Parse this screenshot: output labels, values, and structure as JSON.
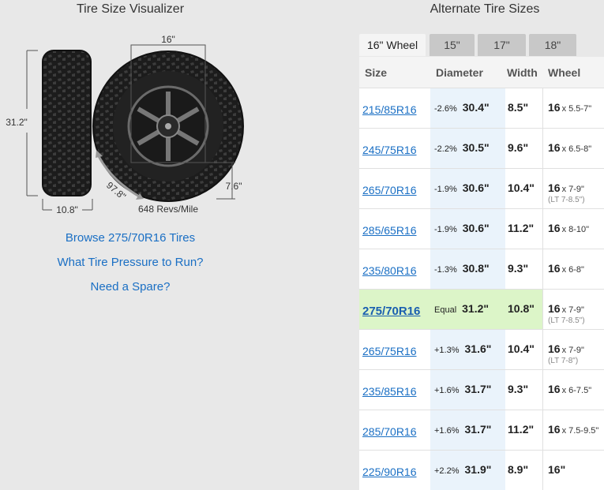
{
  "visualizer": {
    "title": "Tire Size Visualizer",
    "wheel_dim": "16\"",
    "height_dim": "31.2\"",
    "width_dim": "10.8\"",
    "circumference_dim": "97.8\"",
    "sidewall_dim": "7.6\"",
    "revs": "648 Revs/Mile",
    "links": [
      "Browse 275/70R16 Tires",
      "What Tire Pressure to Run?",
      "Need a Spare?"
    ]
  },
  "alternates": {
    "title": "Alternate Tire Sizes",
    "tabs": [
      "16\" Wheel",
      "15\"",
      "17\"",
      "18\""
    ],
    "headers": {
      "size": "Size",
      "diameter": "Diameter",
      "width": "Width",
      "wheel": "Wheel"
    },
    "rows": [
      {
        "size": "215/85R16",
        "pct": "-2.6%",
        "diameter": "30.4\"",
        "width": "8.5\"",
        "wheel": "16",
        "range": "x 5.5-7\"",
        "lt": ""
      },
      {
        "size": "245/75R16",
        "pct": "-2.2%",
        "diameter": "30.5\"",
        "width": "9.6\"",
        "wheel": "16",
        "range": "x 6.5-8\"",
        "lt": ""
      },
      {
        "size": "265/70R16",
        "pct": "-1.9%",
        "diameter": "30.6\"",
        "width": "10.4\"",
        "wheel": "16",
        "range": "x 7-9\"",
        "lt": "(LT 7-8.5\")"
      },
      {
        "size": "285/65R16",
        "pct": "-1.9%",
        "diameter": "30.6\"",
        "width": "11.2\"",
        "wheel": "16",
        "range": "x 8-10\"",
        "lt": ""
      },
      {
        "size": "235/80R16",
        "pct": "-1.3%",
        "diameter": "30.8\"",
        "width": "9.3\"",
        "wheel": "16",
        "range": "x 6-8\"",
        "lt": ""
      },
      {
        "size": "275/70R16",
        "pct": "Equal",
        "diameter": "31.2\"",
        "width": "10.8\"",
        "wheel": "16",
        "range": "x 7-9\"",
        "lt": "(LT 7-8.5\")",
        "current": true
      },
      {
        "size": "265/75R16",
        "pct": "+1.3%",
        "diameter": "31.6\"",
        "width": "10.4\"",
        "wheel": "16",
        "range": "x 7-9\"",
        "lt": "(LT 7-8\")"
      },
      {
        "size": "235/85R16",
        "pct": "+1.6%",
        "diameter": "31.7\"",
        "width": "9.3\"",
        "wheel": "16",
        "range": "x 6-7.5\"",
        "lt": ""
      },
      {
        "size": "285/70R16",
        "pct": "+1.6%",
        "diameter": "31.7\"",
        "width": "11.2\"",
        "wheel": "16",
        "range": "x 7.5-9.5\"",
        "lt": ""
      },
      {
        "size": "225/90R16",
        "pct": "+2.2%",
        "diameter": "31.9\"",
        "width": "8.9\"",
        "wheel": "16\"",
        "range": "",
        "lt": ""
      }
    ]
  }
}
